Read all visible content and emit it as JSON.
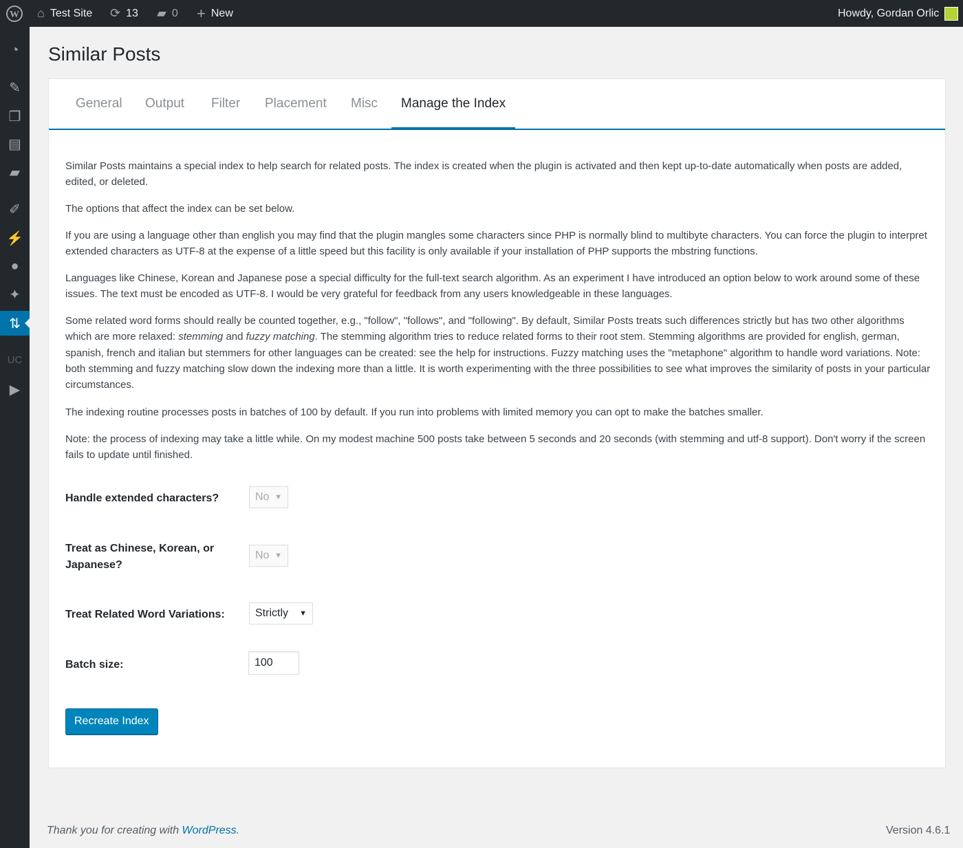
{
  "admin_bar": {
    "site_name": "Test Site",
    "updates_count": "13",
    "comments_count": "0",
    "new_label": "New",
    "greeting": "Howdy, Gordan Orlic"
  },
  "sidebar": {
    "icons": [
      "dashboard-icon",
      "pin-icon",
      "media-icon",
      "pages-icon",
      "comments-icon",
      "appearance-icon",
      "plugins-icon",
      "users-icon",
      "tools-icon",
      "settings-icon",
      "uc-icon",
      "play-icon"
    ],
    "uc_label": "UC"
  },
  "page": {
    "title": "Similar Posts"
  },
  "tabs": [
    {
      "label": "General"
    },
    {
      "label": "Output"
    },
    {
      "label": "Filter"
    },
    {
      "label": "Placement"
    },
    {
      "label": "Misc"
    },
    {
      "label": "Manage the Index"
    }
  ],
  "active_tab": "Manage the Index",
  "intro": {
    "p1": "Similar Posts maintains a special index to help search for related posts. The index is created when the plugin is activated and then kept up-to-date automatically when posts are added, edited, or deleted.",
    "p2": "The options that affect the index can be set below.",
    "p3": "If you are using a language other than english you may find that the plugin mangles some characters since PHP is normally blind to multibyte characters. You can force the plugin to interpret extended characters as UTF-8 at the expense of a little speed but this facility is only available if your installation of PHP supports the mbstring functions.",
    "p4": "Languages like Chinese, Korean and Japanese pose a special difficulty for the full-text search algorithm. As an experiment I have introduced an option below to work around some of these issues. The text must be encoded as UTF-8. I would be very grateful for feedback from any users knowledgeable in these languages.",
    "p5a": "Some related word forms should really be counted together, e.g., \"follow\", \"follows\", and \"following\". By default, Similar Posts treats such differences strictly but has two other algorithms which are more relaxed: ",
    "p5_em1": "stemming",
    "p5_and": " and ",
    "p5_em2": "fuzzy matching",
    "p5b": ". The stemming algorithm tries to reduce related forms to their root stem. Stemming algorithms are provided for english, german, spanish, french and italian but stemmers for other languages can be created: see the help for instructions. Fuzzy matching uses the \"metaphone\" algorithm to handle word variations. Note: both stemming and fuzzy matching slow down the indexing more than a little. It is worth experimenting with the three possibilities to see what improves the similarity of posts in your particular circumstances.",
    "p6": "The indexing routine processes posts in batches of 100 by default. If you run into problems with limited memory you can opt to make the batches smaller.",
    "p7": "Note: the process of indexing may take a little while. On my modest machine 500 posts take between 5 seconds and 20 seconds (with stemming and utf-8 support). Don't worry if the screen fails to update until finished."
  },
  "form": {
    "extended_chars": {
      "label": "Handle extended characters?",
      "value": "No"
    },
    "cjk": {
      "label": "Treat as Chinese, Korean, or Japanese?",
      "value": "No"
    },
    "word_variations": {
      "label": "Treat Related Word Variations:",
      "value": "Strictly"
    },
    "batch_size": {
      "label": "Batch size:",
      "value": "100"
    },
    "submit_label": "Recreate Index"
  },
  "footer": {
    "thanks_prefix": "Thank you for creating with ",
    "thanks_link": "WordPress",
    "thanks_suffix": ".",
    "version": "Version 4.6.1"
  }
}
